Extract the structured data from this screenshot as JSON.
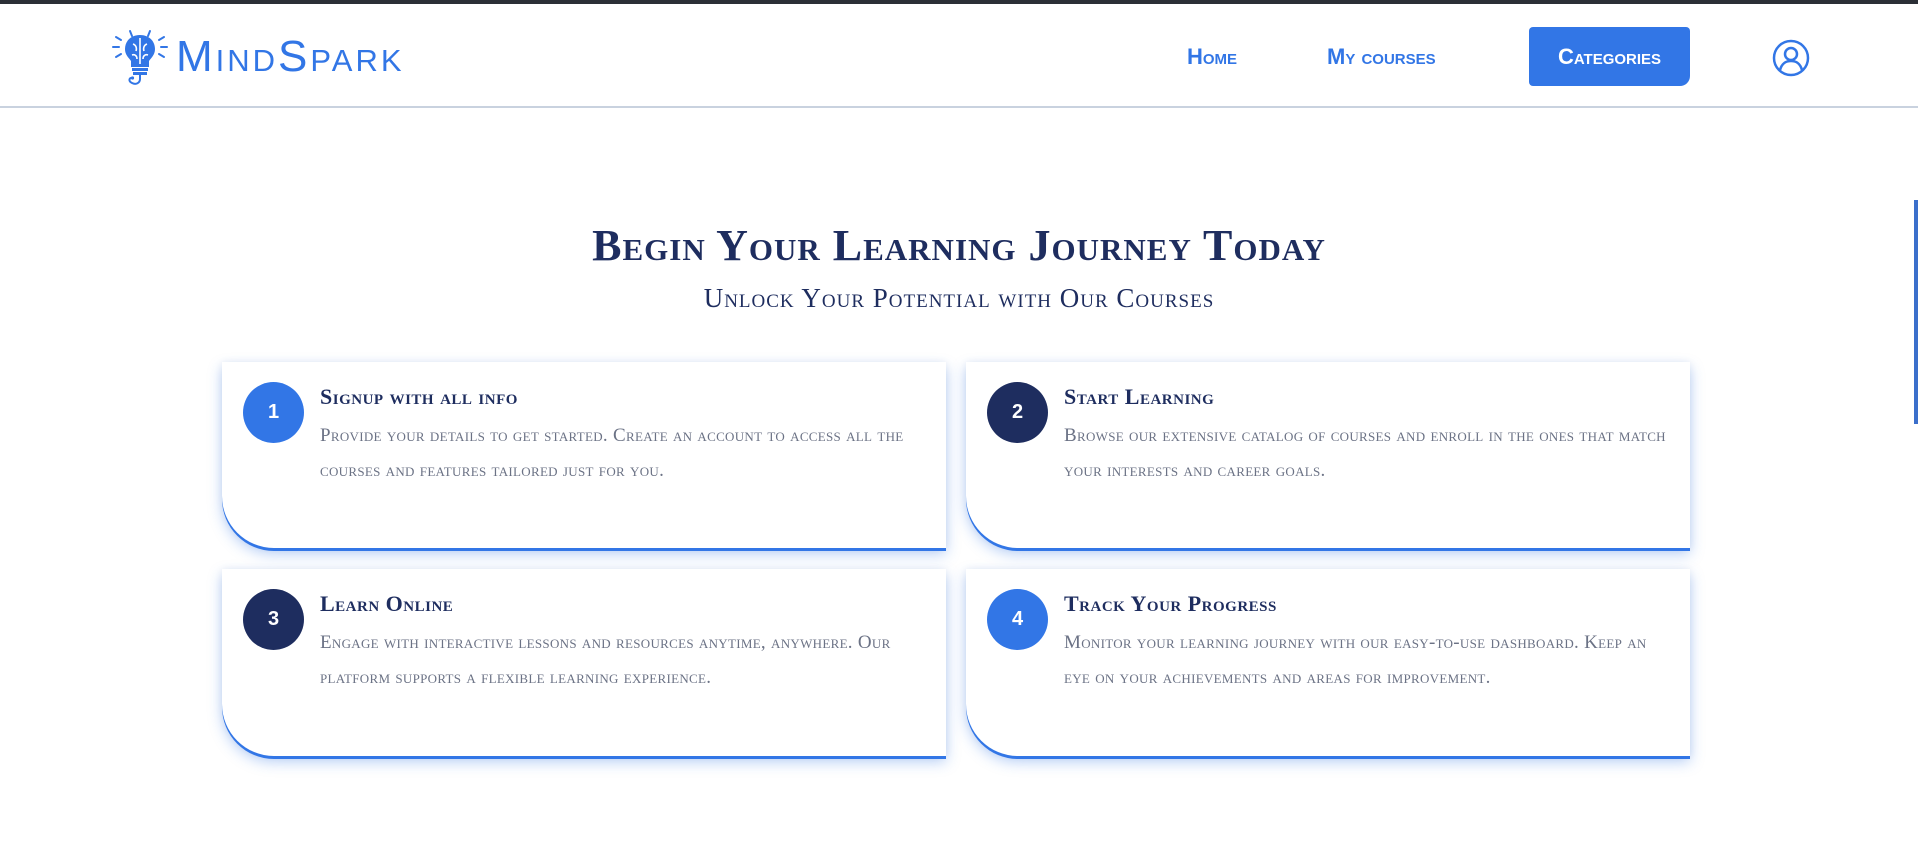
{
  "brand": {
    "name": "MindSpark"
  },
  "nav": {
    "home": "Home",
    "my_courses": "My courses",
    "categories": "Categories",
    "user_icon": "user-circle-icon"
  },
  "hero": {
    "title": "Begin Your Learning Journey Today",
    "subtitle": "Unlock Your Potential with Our Courses"
  },
  "steps": [
    {
      "number": "1",
      "title": "Signup with all info",
      "text": "Provide your details to get started. Create an account to access all the courses and features tailored just for you.",
      "circle_color": "#3276e6"
    },
    {
      "number": "2",
      "title": "Start Learning",
      "text": "Browse our extensive catalog of courses and enroll in the ones that match your interests and career goals.",
      "circle_color": "#1e2d5f"
    },
    {
      "number": "3",
      "title": "Learn Online",
      "text": "Engage with interactive lessons and resources anytime, anywhere. Our platform supports a flexible learning experience.",
      "circle_color": "#1e2d5f"
    },
    {
      "number": "4",
      "title": "Track Your Progress",
      "text": "Monitor your learning journey with our easy-to-use dashboard. Keep an eye on your achievements and areas for improvement.",
      "circle_color": "#3276e6"
    }
  ],
  "colors": {
    "accent": "#3276e6",
    "navy": "#1e2d5f",
    "muted_text": "#6b7285"
  }
}
